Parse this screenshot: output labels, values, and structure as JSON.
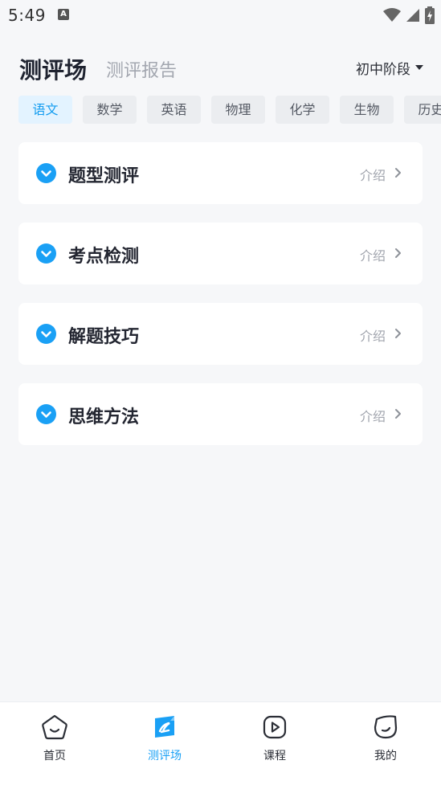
{
  "status_bar": {
    "time": "5:49",
    "notification_glyph": "A"
  },
  "header": {
    "tabs": [
      {
        "label": "测评场",
        "active": true
      },
      {
        "label": "测评报告",
        "active": false
      }
    ],
    "stage_select": {
      "value": "初中阶段"
    }
  },
  "subjects": [
    {
      "label": "语文",
      "active": true
    },
    {
      "label": "数学",
      "active": false
    },
    {
      "label": "英语",
      "active": false
    },
    {
      "label": "物理",
      "active": false
    },
    {
      "label": "化学",
      "active": false
    },
    {
      "label": "生物",
      "active": false
    },
    {
      "label": "历史",
      "active": false
    }
  ],
  "cards": [
    {
      "title": "题型测评",
      "intro_label": "介绍"
    },
    {
      "title": "考点检测",
      "intro_label": "介绍"
    },
    {
      "title": "解题技巧",
      "intro_label": "介绍"
    },
    {
      "title": "思维方法",
      "intro_label": "介绍"
    }
  ],
  "bottom_nav": [
    {
      "label": "首页",
      "icon": "home-face-icon",
      "active": false
    },
    {
      "label": "测评场",
      "icon": "assessment-icon",
      "active": true
    },
    {
      "label": "课程",
      "icon": "course-play-icon",
      "active": false
    },
    {
      "label": "我的",
      "icon": "profile-face-icon",
      "active": false
    }
  ],
  "colors": {
    "accent": "#1aa0f5",
    "background": "#f6f7f9",
    "chip_active_bg": "#e3f3ff",
    "chip_bg": "#ebedf0"
  }
}
